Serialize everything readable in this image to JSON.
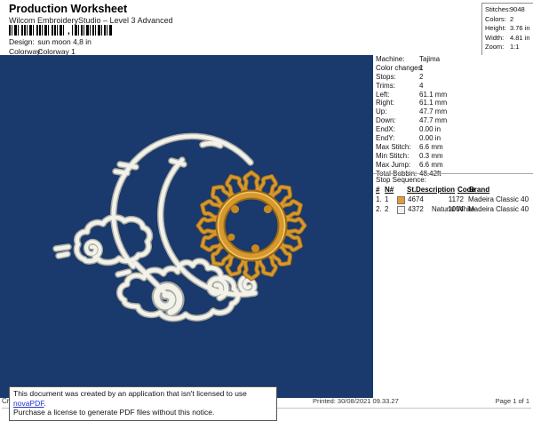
{
  "header": {
    "title": "Production Worksheet",
    "subtitle": "Wilcom EmbroideryStudio – Level 3 Advanced",
    "design_label": "Design:",
    "design_value": "sun moon 4,8 in",
    "colorway_label": "Colorway:",
    "colorway_value": "Colorway 1",
    "barcode_comma": ","
  },
  "summary_box": {
    "rows": [
      {
        "label": "Stitches:",
        "value": "9048"
      },
      {
        "label": "Colors:",
        "value": "2"
      },
      {
        "label": "Height:",
        "value": "3.76 in"
      },
      {
        "label": "Width:",
        "value": "4.81 in"
      },
      {
        "label": "Zoom:",
        "value": "1:1"
      }
    ]
  },
  "machine_panel": {
    "rows": [
      {
        "label": "Machine:",
        "value": "Tajima"
      },
      {
        "label": "Color changes:",
        "value": "1"
      },
      {
        "label": "Stops:",
        "value": "2"
      },
      {
        "label": "Trims:",
        "value": "4"
      },
      {
        "label": "Left:",
        "value": "61.1 mm"
      },
      {
        "label": "Right:",
        "value": "61.1 mm"
      },
      {
        "label": "Up:",
        "value": "47.7 mm"
      },
      {
        "label": "Down:",
        "value": "47.7 mm"
      },
      {
        "label": "EndX:",
        "value": "0.00 in"
      },
      {
        "label": "EndY:",
        "value": "0.00 in"
      },
      {
        "label": "Max Stitch:",
        "value": "6.6 mm"
      },
      {
        "label": "Min Stitch:",
        "value": "0.3 mm"
      },
      {
        "label": "Max Jump:",
        "value": "6.6 mm"
      },
      {
        "label": "Total Bobbin:",
        "value": "48.42ft"
      }
    ]
  },
  "stop_sequence": {
    "title": "Stop Sequence:",
    "columns": {
      "num": "#",
      "n": "N#",
      "st": "St.",
      "description": "Description",
      "code": "Code",
      "brand": "Brand"
    },
    "rows": [
      {
        "num": "1.",
        "n": "1",
        "swatch_color": "#E39A35",
        "st": "4674",
        "description": "",
        "code": "1172",
        "brand": "Madeira Classic 40"
      },
      {
        "num": "2.",
        "n": "2",
        "swatch_color": "#F2F2EC",
        "st": "4372",
        "description": "Natural White",
        "code": "1004",
        "brand": "Madeira Classic 40"
      }
    ]
  },
  "design_canvas": {
    "background_color": "#1A396C",
    "moon_color": "#F2F2EA",
    "moon_shadow_color": "#A9AAA0",
    "sun_color": "#D6992E"
  },
  "notice": {
    "clipped_text": "Cr",
    "line1_before": "This document was created by an application that isn't licensed to use ",
    "link_text": "novaPDF",
    "line1_after": ".",
    "line2": "Purchase a license to generate PDF files without this notice."
  },
  "footer": {
    "printed": "Printed: 30/08/2021 09.33.27",
    "page": "Page 1 of 1"
  }
}
